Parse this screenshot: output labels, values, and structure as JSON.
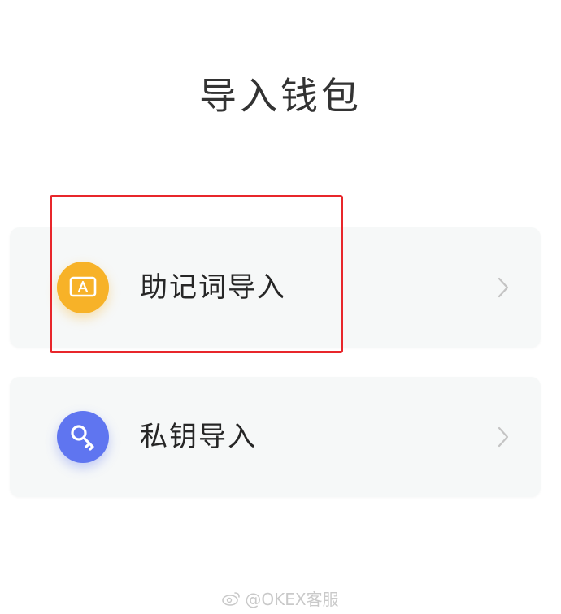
{
  "header": {
    "title": "导入钱包"
  },
  "options": [
    {
      "label": "助记词导入",
      "icon": "mnemonic-icon",
      "icon_color": "#f7b228"
    },
    {
      "label": "私钥导入",
      "icon": "key-icon",
      "icon_color": "#5f75f0"
    }
  ],
  "highlight": {
    "color": "#e8262b"
  },
  "watermark": {
    "text": "@OKEX客服"
  }
}
